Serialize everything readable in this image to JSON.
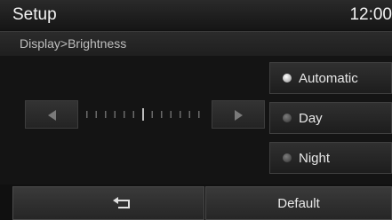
{
  "header": {
    "title": "Setup",
    "clock": "12:00"
  },
  "breadcrumb": {
    "path": "Display>Brightness"
  },
  "brightness": {
    "level": 7,
    "max": 13
  },
  "modes": [
    {
      "label": "Automatic",
      "selected": true
    },
    {
      "label": "Day",
      "selected": false
    },
    {
      "label": "Night",
      "selected": false
    }
  ],
  "footer": {
    "back_icon": "return-arrow-icon",
    "default_label": "Default"
  },
  "colors": {
    "background": "#141414",
    "button_text": "#e8e8e8",
    "selected_dot": "#ffffff"
  }
}
